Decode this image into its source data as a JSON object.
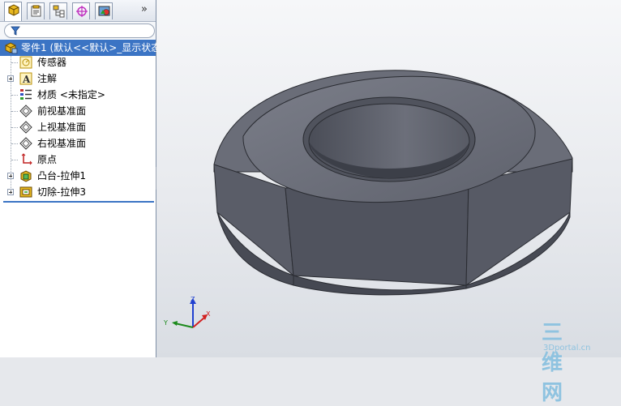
{
  "tabs": [
    {
      "name": "featuremanager"
    },
    {
      "name": "propertymanager"
    },
    {
      "name": "configurationmanager"
    },
    {
      "name": "dimxpert"
    },
    {
      "name": "display-manager"
    }
  ],
  "tabbar_more": "»",
  "tree": {
    "root": "零件1 (默认<<默认>_显示状态",
    "items": [
      {
        "label": "传感器",
        "icon": "sensor-icon",
        "expandable": false
      },
      {
        "label": "注解",
        "icon": "annotation-icon",
        "expandable": true
      },
      {
        "label": "材质 <未指定>",
        "icon": "material-icon",
        "expandable": false
      },
      {
        "label": "前视基准面",
        "icon": "plane-icon",
        "expandable": false
      },
      {
        "label": "上视基准面",
        "icon": "plane-icon",
        "expandable": false
      },
      {
        "label": "右视基准面",
        "icon": "plane-icon",
        "expandable": false
      },
      {
        "label": "原点",
        "icon": "origin-icon",
        "expandable": false
      },
      {
        "label": "凸台-拉伸1",
        "icon": "boss-extrude-icon",
        "expandable": true
      },
      {
        "label": "切除-拉伸3",
        "icon": "cut-extrude-icon",
        "expandable": true
      }
    ]
  },
  "triad": {
    "x": "X",
    "y": "Y",
    "z": "Z"
  },
  "watermark": {
    "main": "三维网",
    "sub": "3Dportal.cn"
  },
  "colors": {
    "selection": "#3b74c4",
    "part": "#5c5f6b",
    "axis_x": "#d22020",
    "axis_y": "#1c8a1c",
    "axis_z": "#2040d0"
  }
}
